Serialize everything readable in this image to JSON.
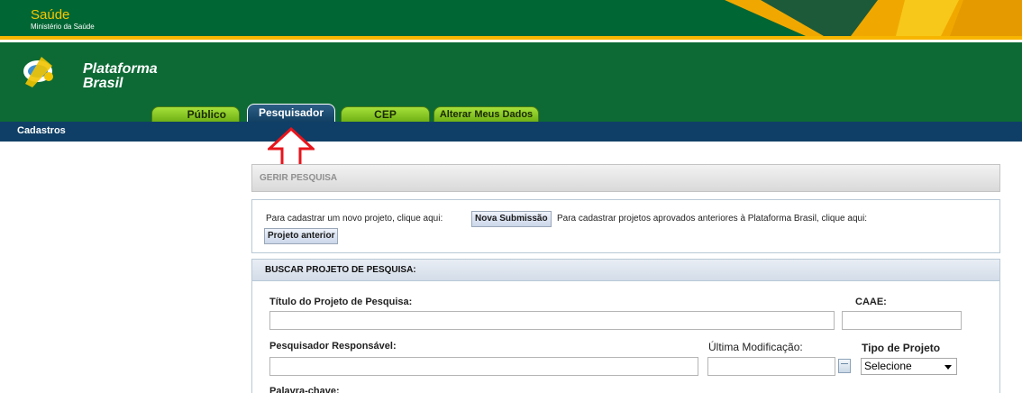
{
  "gov": {
    "title": "Saúde",
    "subtitle": "Ministério da Saúde"
  },
  "logo": {
    "line1": "Plataforma",
    "line2": "Brasil"
  },
  "tabs": [
    {
      "label": "Público"
    },
    {
      "label": "Pesquisador",
      "active": true
    },
    {
      "label": "CEP"
    },
    {
      "label": "Alterar Meus Dados"
    }
  ],
  "nav": {
    "item": "Cadastros"
  },
  "gerir": {
    "title": "GERIR PESQUISA"
  },
  "submission": {
    "text_before": "Para cadastrar um novo projeto, clique aqui:",
    "new_button": "Nova Submissão",
    "text_after": "Para cadastrar projetos aprovados anteriores à Plataforma Brasil, clique aqui:",
    "previous_button": "Projeto anterior"
  },
  "search": {
    "header": "BUSCAR PROJETO DE PESQUISA:",
    "title_label": "Título do Projeto de Pesquisa:",
    "title_value": "",
    "caae_label": "CAAE:",
    "caae_value": "",
    "researcher_label": "Pesquisador Responsável:",
    "researcher_value": "",
    "last_mod_label": "Última Modificação:",
    "last_mod_value": "",
    "project_type_label": "Tipo de Projeto",
    "project_type_selected": "Selecione",
    "keyword_label": "Palavra-chave:"
  },
  "colors": {
    "gov_green": "#006633",
    "header_green": "#0d6a35",
    "nav_blue": "#0f3f66",
    "tab_green": "#6fb114",
    "arrow_red": "#e8141c"
  }
}
